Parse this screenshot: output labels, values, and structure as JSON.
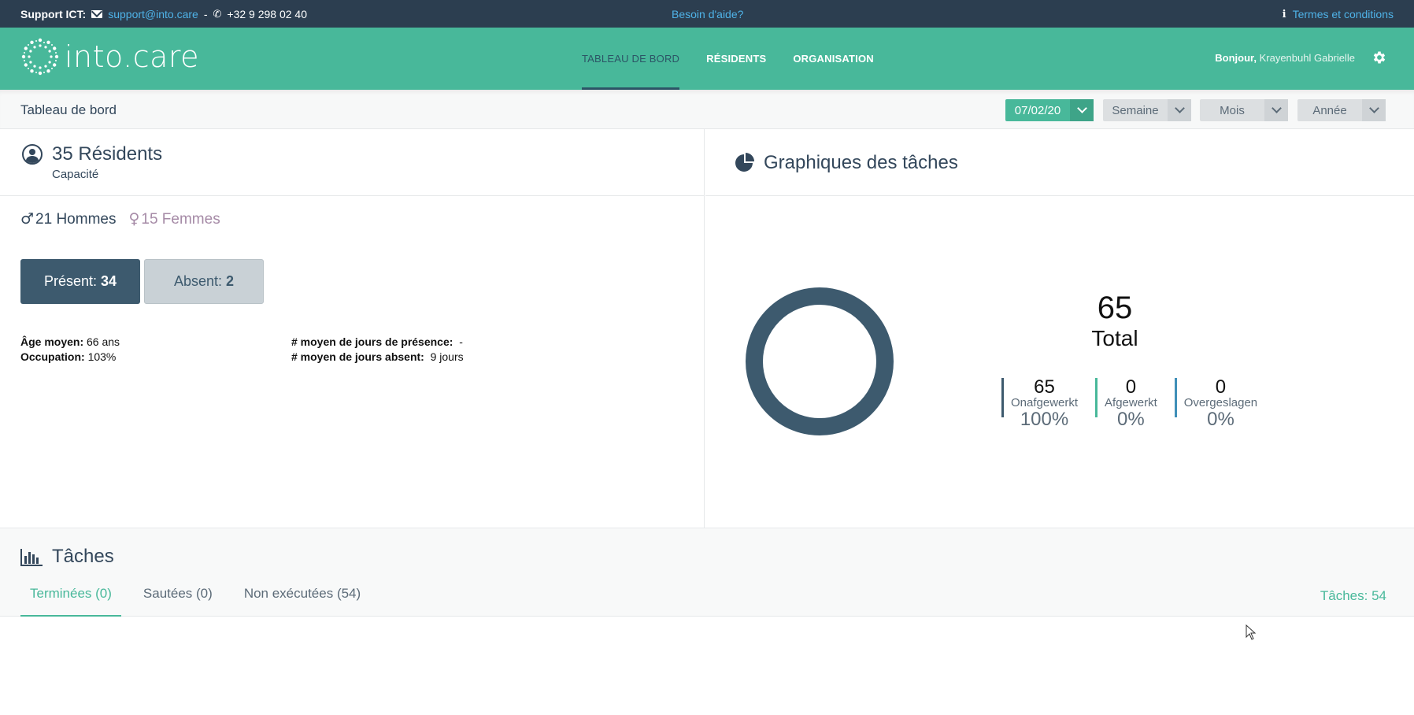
{
  "topbar": {
    "support_label": "Support ICT:",
    "email": "support@into.care",
    "separator": "-",
    "phone": "+32 9 298 02 40",
    "help": "Besoin d'aide?",
    "terms": "Termes et conditions"
  },
  "header": {
    "logo_text": "into.care",
    "nav": [
      {
        "label": "TABLEAU DE BORD",
        "active": true
      },
      {
        "label": "RÉSIDENTS",
        "active": false
      },
      {
        "label": "ORGANISATION",
        "active": false
      }
    ],
    "greeting": "Bonjour,",
    "user_name": "Krayenbuhl Gabrielle"
  },
  "subbar": {
    "title": "Tableau de bord",
    "date_value": "07/02/20",
    "filters": [
      "Semaine",
      "Mois",
      "Année"
    ]
  },
  "residents": {
    "title": "35 Résidents",
    "subtitle": "Capacité",
    "male": "21 Hommes",
    "female": "15 Femmes",
    "present_label": "Présent:",
    "present_value": "34",
    "absent_label": "Absent:",
    "absent_value": "2",
    "age_label": "Âge moyen:",
    "age_value": "66 ans",
    "occupation_label": "Occupation:",
    "occupation_value": "103%",
    "presence_days_label": "# moyen de jours de présence:",
    "presence_days_value": "-",
    "absent_days_label": "# moyen de jours absent:",
    "absent_days_value": "9 jours"
  },
  "chart_panel": {
    "title": "Graphiques des tâches",
    "total_value": "65",
    "total_label": "Total",
    "legend": [
      {
        "count": "65",
        "label": "Onafgewerkt",
        "percent": "100%",
        "color": "#3d5a6e"
      },
      {
        "count": "0",
        "label": "Afgewerkt",
        "percent": "0%",
        "color": "#48b89a"
      },
      {
        "count": "0",
        "label": "Overgeslagen",
        "percent": "0%",
        "color": "#3f8fb8"
      }
    ]
  },
  "chart_data": {
    "type": "pie",
    "categories": [
      "Onafgewerkt",
      "Afgewerkt",
      "Overgeslagen"
    ],
    "values": [
      65,
      0,
      0
    ],
    "colors": [
      "#3d5a6e",
      "#48b89a",
      "#3f8fb8"
    ]
  },
  "tasks": {
    "title": "Tâches",
    "tabs": [
      {
        "label": "Terminées (0)",
        "active": true
      },
      {
        "label": "Sautées (0)",
        "active": false
      },
      {
        "label": "Non exécutées (54)",
        "active": false
      }
    ],
    "count": "Tâches: 54"
  },
  "colors": {
    "brand": "#48b89a",
    "dark": "#2c3e50",
    "navy": "#3d5a6e",
    "link": "#4fb3e8"
  }
}
